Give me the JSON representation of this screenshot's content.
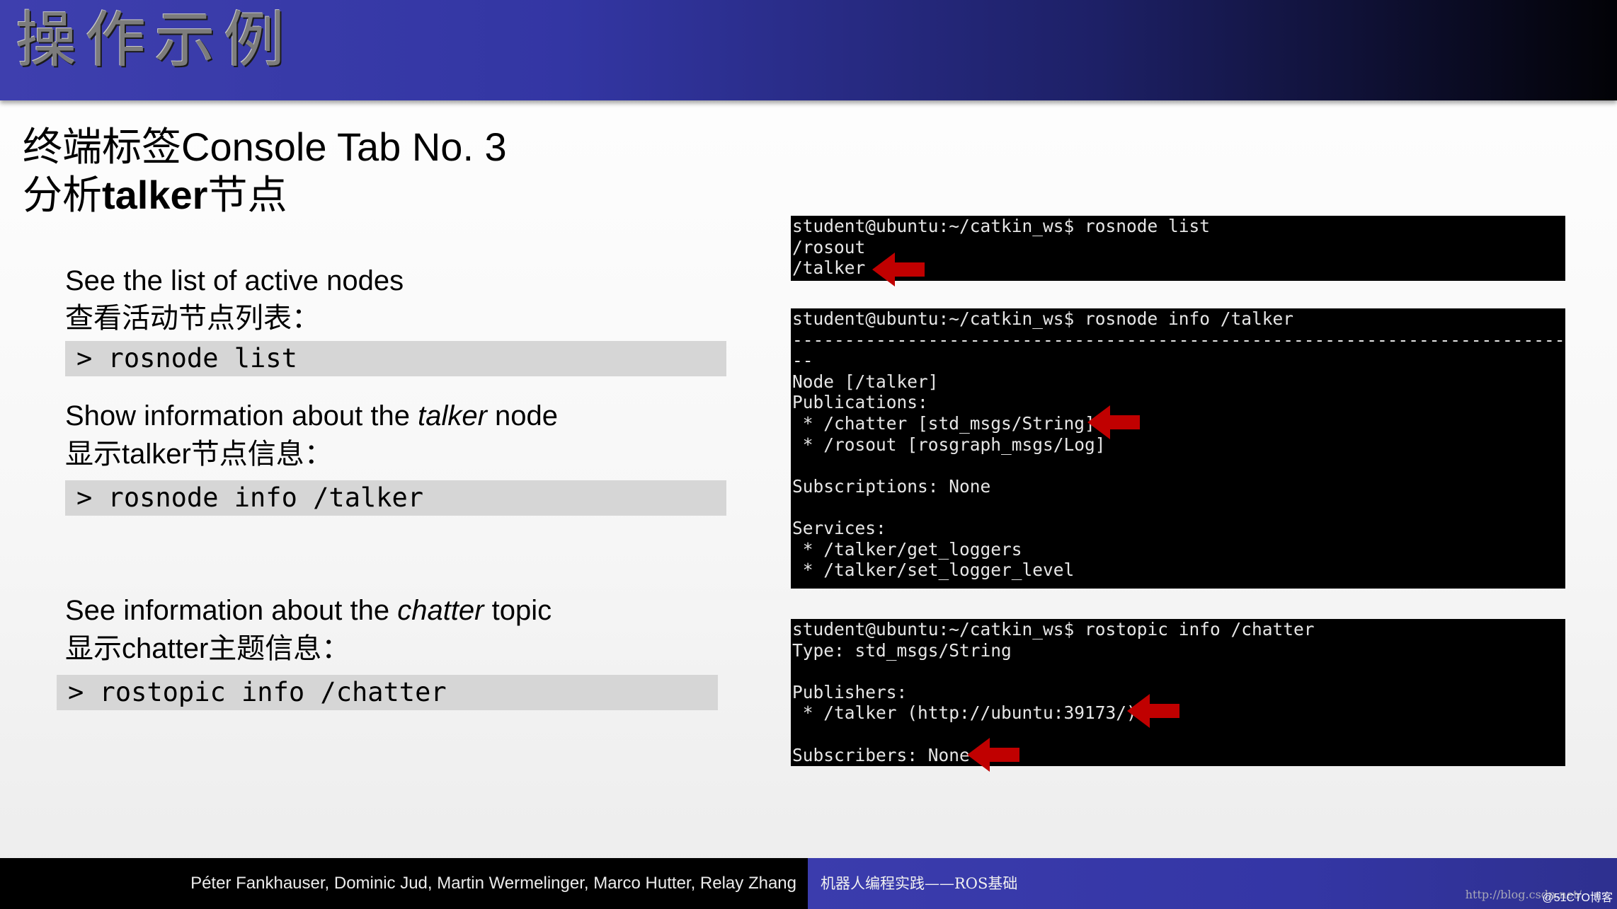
{
  "header": {
    "title": "操作示例"
  },
  "subtitle": {
    "line1": "终端标签Console Tab No. 3",
    "line2_prefix": "分析",
    "line2_bold": "talker",
    "line2_suffix": "节点"
  },
  "sections": [
    {
      "english": "See the list of active nodes",
      "chinese": "查看活动节点列表：",
      "command": "> rosnode list"
    },
    {
      "english_prefix": "Show information about the ",
      "english_italic": "talker",
      "english_suffix": " node",
      "chinese": "显示talker节点信息：",
      "command": "> rosnode info /talker"
    },
    {
      "english_prefix": "See information about the ",
      "english_italic": "chatter",
      "english_suffix": " topic",
      "chinese": "显示chatter主题信息：",
      "command": "> rostopic info /chatter"
    }
  ],
  "terminals": [
    {
      "lines": [
        "student@ubuntu:~/catkin_ws$ rosnode list",
        "/rosout",
        "/talker"
      ]
    },
    {
      "lines": [
        "student@ubuntu:~/catkin_ws$ rosnode info /talker",
        "--------------------------------------------------------------------------",
        "--",
        "Node [/talker]",
        "Publications:",
        " * /chatter [std_msgs/String]",
        " * /rosout [rosgraph_msgs/Log]",
        "",
        "Subscriptions: None",
        "",
        "Services:",
        " * /talker/get_loggers",
        " * /talker/set_logger_level"
      ]
    },
    {
      "lines": [
        "student@ubuntu:~/catkin_ws$ rostopic info /chatter",
        "Type: std_msgs/String",
        "",
        "Publishers:",
        " * /talker (http://ubuntu:39173/)",
        "",
        "Subscribers: None"
      ]
    }
  ],
  "footer": {
    "authors": "Péter Fankhauser, Dominic Jud, Martin Wermelinger, Marco Hutter, Relay Zhang",
    "course": "机器人编程实践——ROS基础",
    "watermark": "http://blog.csdn.net/",
    "badge": "@51CTO博客"
  },
  "colors": {
    "header_left": "#3e3fae",
    "header_right": "#020206",
    "command_bg": "#d6d6d6",
    "terminal_bg": "#000000",
    "arrow": "#c00000",
    "footer_course_bg": "#3b3cad"
  }
}
